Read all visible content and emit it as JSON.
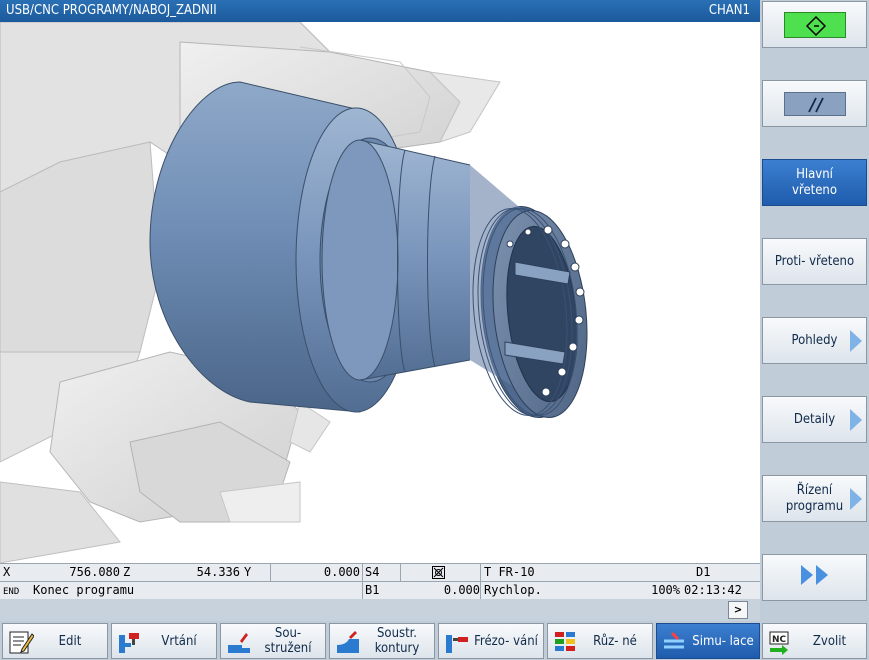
{
  "title": {
    "path": "USB/CNC PROGRAMY/NABOJ_ZADNII",
    "channel": "CHAN1"
  },
  "status": {
    "x_label": "X",
    "x_value": "756.080",
    "z_label": "Z",
    "z_value": "54.336",
    "y_label": "Y",
    "y_value": "0.000",
    "spindle": "S4",
    "tool": "T FR-10",
    "d_label": "D1",
    "end_tag": "END",
    "message": "Konec programu",
    "b_label": "B1",
    "b_value": "0.000",
    "feed_mode": "Rychlop.",
    "override": "100%",
    "time": "02:13:42",
    "more": ">"
  },
  "right_softkeys": [
    {
      "label": "",
      "icon": "start-diamond-icon"
    },
    {
      "label": "",
      "icon": "double-slash-icon"
    },
    {
      "label": "Hlavní vřeteno",
      "active": true
    },
    {
      "label": "Proti- vřeteno"
    },
    {
      "label": "Pohledy",
      "arrow": true
    },
    {
      "label": "Detaily",
      "arrow": true
    },
    {
      "label": "Řízení programu",
      "arrow": true
    },
    {
      "label": "",
      "icon": "double-chevron-right-icon"
    }
  ],
  "bottom_softkeys": [
    {
      "label": "Edit",
      "icon": "edit-icon"
    },
    {
      "label": "Vrtání",
      "icon": "drilling-icon"
    },
    {
      "label": "Sou- stružení",
      "icon": "turning-icon"
    },
    {
      "label": "Soustr. kontury",
      "icon": "contour-turning-icon"
    },
    {
      "label": "Frézo- vání",
      "icon": "milling-icon"
    },
    {
      "label": "Růz- né",
      "icon": "various-icon"
    },
    {
      "label": "Simu- lace",
      "icon": "simulation-icon",
      "active": true
    },
    {
      "label": "Zvolit",
      "icon": "nc-select-icon"
    }
  ],
  "colors": {
    "title_bar": "#1f62a8",
    "active_key": "#2a6cc0",
    "part": "#6f8fb8",
    "chuck": "#e6e6e6",
    "start_green": "#4ee04e"
  }
}
